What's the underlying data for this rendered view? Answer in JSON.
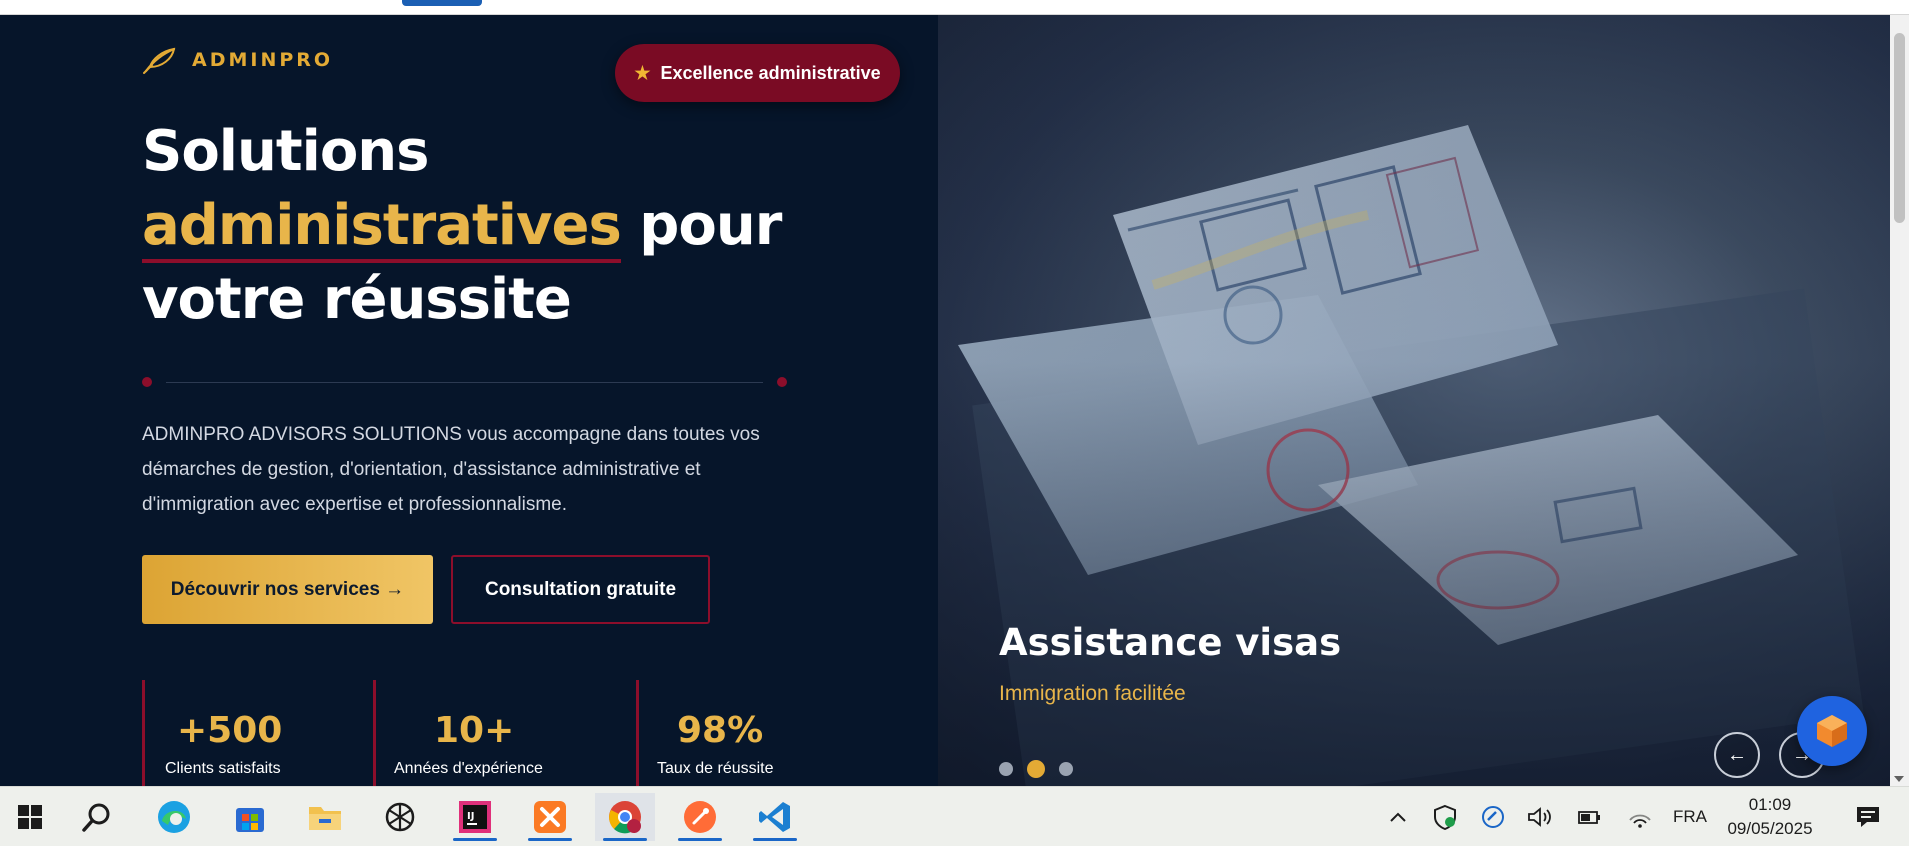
{
  "brand": {
    "name": "ADMINPRO"
  },
  "hero": {
    "headline_line1": "Solutions",
    "headline_accent": "administratives",
    "headline_line2_rest": " pour",
    "headline_line3": "votre réussite",
    "intro": "ADMINPRO ADVISORS SOLUTIONS vous accompagne dans toutes vos démarches de gestion, d'orientation, d'assistance administrative et d'immigration avec expertise et professionnalisme.",
    "primary_button": "Découvrir nos services →",
    "secondary_button": "Consultation gratuite"
  },
  "stats": [
    {
      "value": "+500",
      "label": "Clients satisfaits"
    },
    {
      "value": "10+",
      "label": "Années d'expérience"
    },
    {
      "value": "98%",
      "label": "Taux de réussite"
    }
  ],
  "slider": {
    "badge": "Excellence administrative",
    "title": "Assistance visas",
    "subtitle": "Immigration facilitée",
    "dot_count": 3,
    "active_dot": 2,
    "prev_label": "←",
    "next_label": "→"
  },
  "taskbar": {
    "apps": [
      "start-icon",
      "search-icon",
      "edge-icon",
      "store-icon",
      "file-explorer-icon",
      "chatgpt-icon",
      "intellij-icon",
      "xampp-icon",
      "chrome-icon",
      "postman-icon",
      "vscode-icon"
    ],
    "language": "FRA",
    "time": "01:09",
    "date": "09/05/2025"
  },
  "colors": {
    "navy": "#06152a",
    "gold": "#e3aa35",
    "burgundy": "#8c0e2b",
    "fab_blue": "#1f63e0"
  }
}
